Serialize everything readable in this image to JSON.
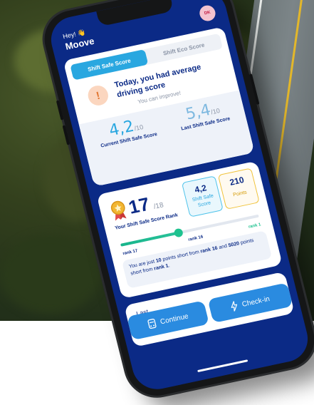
{
  "header": {
    "greeting": "Hey! 👋",
    "app_name": "Moove",
    "avatar_initials": "DK"
  },
  "tabs": {
    "safe": "Shift Safe Score",
    "eco": "Shift Eco Score"
  },
  "summary": {
    "warning_glyph": "!",
    "headline": "Today, you had average driving score",
    "subtext": "You can improve!"
  },
  "scores": {
    "current_value": "4,2",
    "current_unit": "/10",
    "current_label": "Current Shift Safe Score",
    "last_value": "5,4",
    "last_unit": "/10",
    "last_label": "Last Shift Safe Score"
  },
  "rank": {
    "number": "17",
    "out_of": "/18",
    "label": "Your Shift Safe Score Rank",
    "safe_value": "4,2",
    "safe_label": "Shift Safe Score",
    "points_value": "210",
    "points_label": "Points",
    "progress": 0.42,
    "tick_current": "rank 17",
    "tick_next": "rank 16",
    "tick_top": "rank 1",
    "tip_prefix": "You are just ",
    "tip_points": "10",
    "tip_mid1": " points short from ",
    "tip_rank16": "rank 16",
    "tip_mid2": " and ",
    "tip_points2": "5020",
    "tip_mid3": " points short from ",
    "tip_rank1": "rank 1",
    "tip_end": "."
  },
  "last_card": {
    "label": "Last"
  },
  "buttons": {
    "continue": "Continue",
    "checkin": "Check-in"
  },
  "colors": {
    "screen_bg": "#0b2a86",
    "accent": "#29a7e0",
    "points": "#f0c33c",
    "progress": "#1ec28f"
  },
  "icons": [
    "waving-hand-icon",
    "warning-icon",
    "rank-medal-icon",
    "car-icon",
    "lightning-icon"
  ]
}
